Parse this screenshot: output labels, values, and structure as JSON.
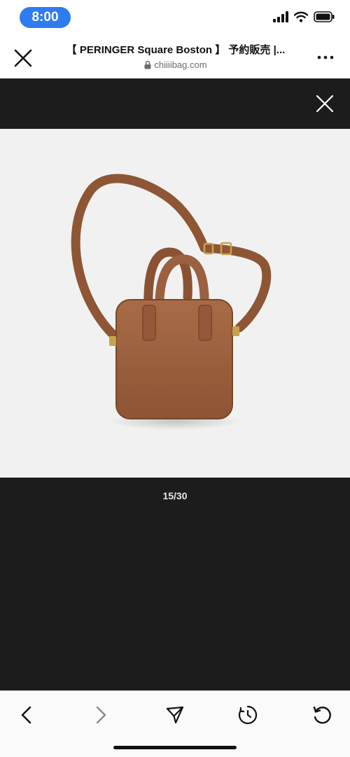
{
  "status": {
    "time": "8:00"
  },
  "browser": {
    "title": "【 PERINGER Square Boston 】 予約販売 |...",
    "url": "chiiiibag.com"
  },
  "viewer": {
    "counter": "15/30"
  },
  "colors": {
    "time_pill": "#2f7bf0",
    "viewer_bg": "#1c1c1c",
    "bag_leather": "#a0623f"
  },
  "icons": {
    "status": [
      "signal-icon",
      "wifi-icon",
      "battery-icon"
    ],
    "header": [
      "close-icon",
      "lock-icon",
      "more-icon"
    ],
    "toolbar": [
      "back-icon",
      "forward-icon",
      "share-icon",
      "history-icon",
      "reload-icon"
    ]
  }
}
